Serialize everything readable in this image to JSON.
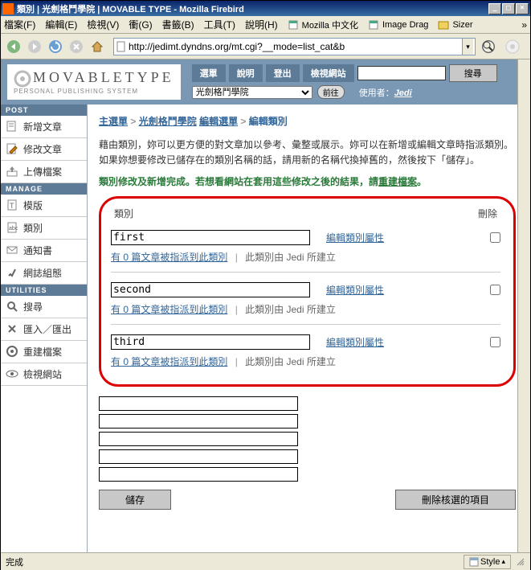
{
  "window": {
    "title": "類別 | 光劍格鬥學院 | MOVABLE TYPE - Mozilla Firebird"
  },
  "menus": {
    "file": "檔案(F)",
    "edit": "編輯(E)",
    "view": "檢視(V)",
    "go": "衝(G)",
    "bookmarks": "書籤(B)",
    "tools": "工具(T)",
    "help": "說明(H)",
    "extra1": "Mozilla 中文化",
    "extra2": "Image Drag",
    "extra3": "Sizer"
  },
  "url": "http://jedimt.dyndns.org/mt.cgi?__mode=list_cat&b",
  "mt": {
    "logo_top": "MOVABLETYPE",
    "logo_sub": "PERSONAL PUBLISHING SYSTEM",
    "tabs": {
      "menu": "選單",
      "help": "說明",
      "logout": "登出",
      "viewsite": "檢視網站"
    },
    "searchbtn": "搜尋",
    "blog_selected": "光劍格鬥學院",
    "go": "前往",
    "user_label": "使用者：",
    "user": "Jedi"
  },
  "sidebar": {
    "post": "POST",
    "post_items": [
      "新增文章",
      "修改文章",
      "上傳檔案"
    ],
    "manage": "MANAGE",
    "manage_items": [
      "模版",
      "類別",
      "通知書",
      "網誌組態"
    ],
    "utilities": "UTILITIES",
    "util_items": [
      "搜尋",
      "匯入／匯出",
      "重建檔案",
      "檢視網站"
    ]
  },
  "breadcrumb": {
    "home": "主選單",
    "blog": "光劍格鬥學院",
    "edit": "編輯選單",
    "current": "編輯類別"
  },
  "intro": "藉由類別，妳可以更方便的對文章加以參考、彙整或展示。妳可以在新增或編輯文章時指派類別。如果妳想要修改已儲存在的類別名稱的話，請用新的名稱代換掉舊的，然後按下「儲存」。",
  "notice_pre": "類別修改及新增完成。若想看網站在套用這些修改之後的結果，請",
  "notice_link": "重建檔案",
  "notice_post": "。",
  "headers": {
    "cat": "類別",
    "del": "刪除"
  },
  "categories": [
    {
      "name": "first",
      "edit": "編輯類別屬性",
      "assigned": "有 0 篇文章被指派到此類別",
      "created": "此類別由 Jedi 所建立"
    },
    {
      "name": "second",
      "edit": "編輯類別屬性",
      "assigned": "有 0 篇文章被指派到此類別",
      "created": "此類別由 Jedi 所建立"
    },
    {
      "name": "third",
      "edit": "編輯類別屬性",
      "assigned": "有 0 篇文章被指派到此類別",
      "created": "此類別由 Jedi 所建立"
    }
  ],
  "buttons": {
    "save": "儲存",
    "delete_selected": "刪除核選的項目"
  },
  "status": {
    "done": "完成",
    "style": "Style"
  }
}
